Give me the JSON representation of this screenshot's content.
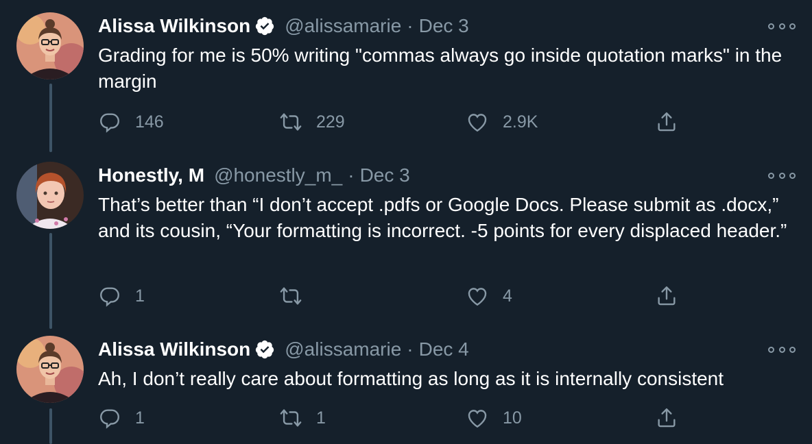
{
  "tweets": [
    {
      "name": "Alissa Wilkinson",
      "verified": true,
      "handle": "@alissamarie",
      "separator": "·",
      "date": "Dec 3",
      "text": "Grading for me is 50% writing \"commas always go inside quotation marks\" in the margin",
      "replies": "146",
      "retweets": "229",
      "likes": "2.9K",
      "avatar_icon": "woman-glasses-avatar"
    },
    {
      "name": "Honestly, M",
      "verified": false,
      "handle": "@honestly_m_",
      "separator": "·",
      "date": "Dec 3",
      "text": "That’s better than “I don’t accept .pdfs or Google Docs. Please submit as .docx,” and its cousin, “Your formatting is incorrect. -5 points for every displaced header.”",
      "replies": "1",
      "retweets": "",
      "likes": "4",
      "avatar_icon": "child-photo-avatar"
    },
    {
      "name": "Alissa Wilkinson",
      "verified": true,
      "handle": "@alissamarie",
      "separator": "·",
      "date": "Dec 4",
      "text": "Ah, I don’t really care about formatting as long as it is internally consistent",
      "replies": "1",
      "retweets": "1",
      "likes": "10",
      "avatar_icon": "woman-glasses-avatar"
    }
  ],
  "icons": {
    "reply": "reply-icon",
    "retweet": "retweet-icon",
    "like": "like-icon",
    "share": "share-icon",
    "more": "more-options-icon",
    "verified": "verified-badge-icon"
  },
  "colors": {
    "background": "#15202b",
    "text": "#ffffff",
    "secondary": "#8899a6",
    "thread_line": "#3d5466",
    "verified_badge": "#ffffff"
  }
}
